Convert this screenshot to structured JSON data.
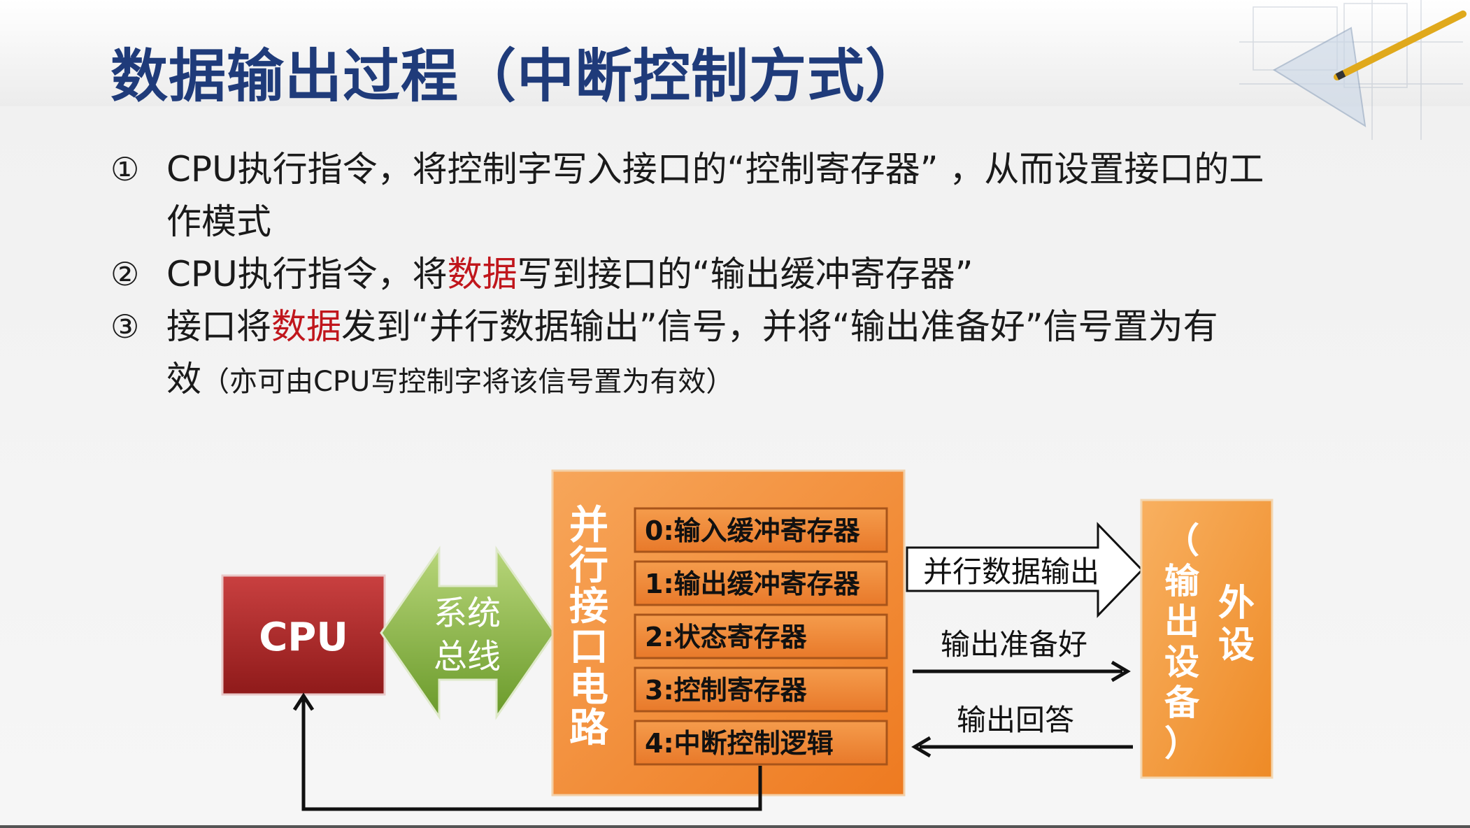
{
  "title": "数据输出过程（中断控制方式）",
  "bullets": [
    {
      "num": "①",
      "parts": [
        {
          "text": "CPU执行指令，将控制字写入接口的“控制寄存器” ，从而设置接口的工",
          "red": false
        },
        {
          "text": "作模式",
          "red": false,
          "newline": true
        }
      ]
    },
    {
      "num": "②",
      "parts": [
        {
          "text": "CPU执行指令，将",
          "red": false
        },
        {
          "text": "数据",
          "red": true
        },
        {
          "text": "写到接口的“输出缓冲寄存器”",
          "red": false
        }
      ]
    },
    {
      "num": "③",
      "parts": [
        {
          "text": "接口将",
          "red": false
        },
        {
          "text": "数据",
          "red": true
        },
        {
          "text": "发到“并行数据输出”信号，并将“输出准备好”信号置为有",
          "red": false
        },
        {
          "text": "效",
          "red": false,
          "newline": true
        },
        {
          "text": "（亦可由CPU写控制字将该信号置为有效）",
          "red": false,
          "small": true
        }
      ]
    }
  ],
  "diagram": {
    "cpu_label": "CPU",
    "bus_label_line1": "系统",
    "bus_label_line2": "总线",
    "interface_label": [
      "并",
      "行",
      "接",
      "口",
      "电",
      "路"
    ],
    "registers": [
      "0:输入缓冲寄存器",
      "1:输出缓冲寄存器",
      "2:状态寄存器",
      "3:控制寄存器",
      "4:中断控制逻辑"
    ],
    "signal_parallel_out": "并行数据输出",
    "signal_ready": "输出准备好",
    "signal_ack": "输出回答",
    "peripheral_line1": [
      "外",
      "设"
    ],
    "peripheral_line2": [
      "（",
      "输",
      "出",
      "设",
      "备",
      "）"
    ]
  },
  "colors": {
    "title": "#1f3b7a",
    "highlight": "#c0161c",
    "cpu_box": "#b02a2a",
    "bus_arrow": "#7fae3a",
    "interface_box": "#f5923e",
    "register_box": "#ef8a3a",
    "peripheral_box": "#f49a3c"
  }
}
